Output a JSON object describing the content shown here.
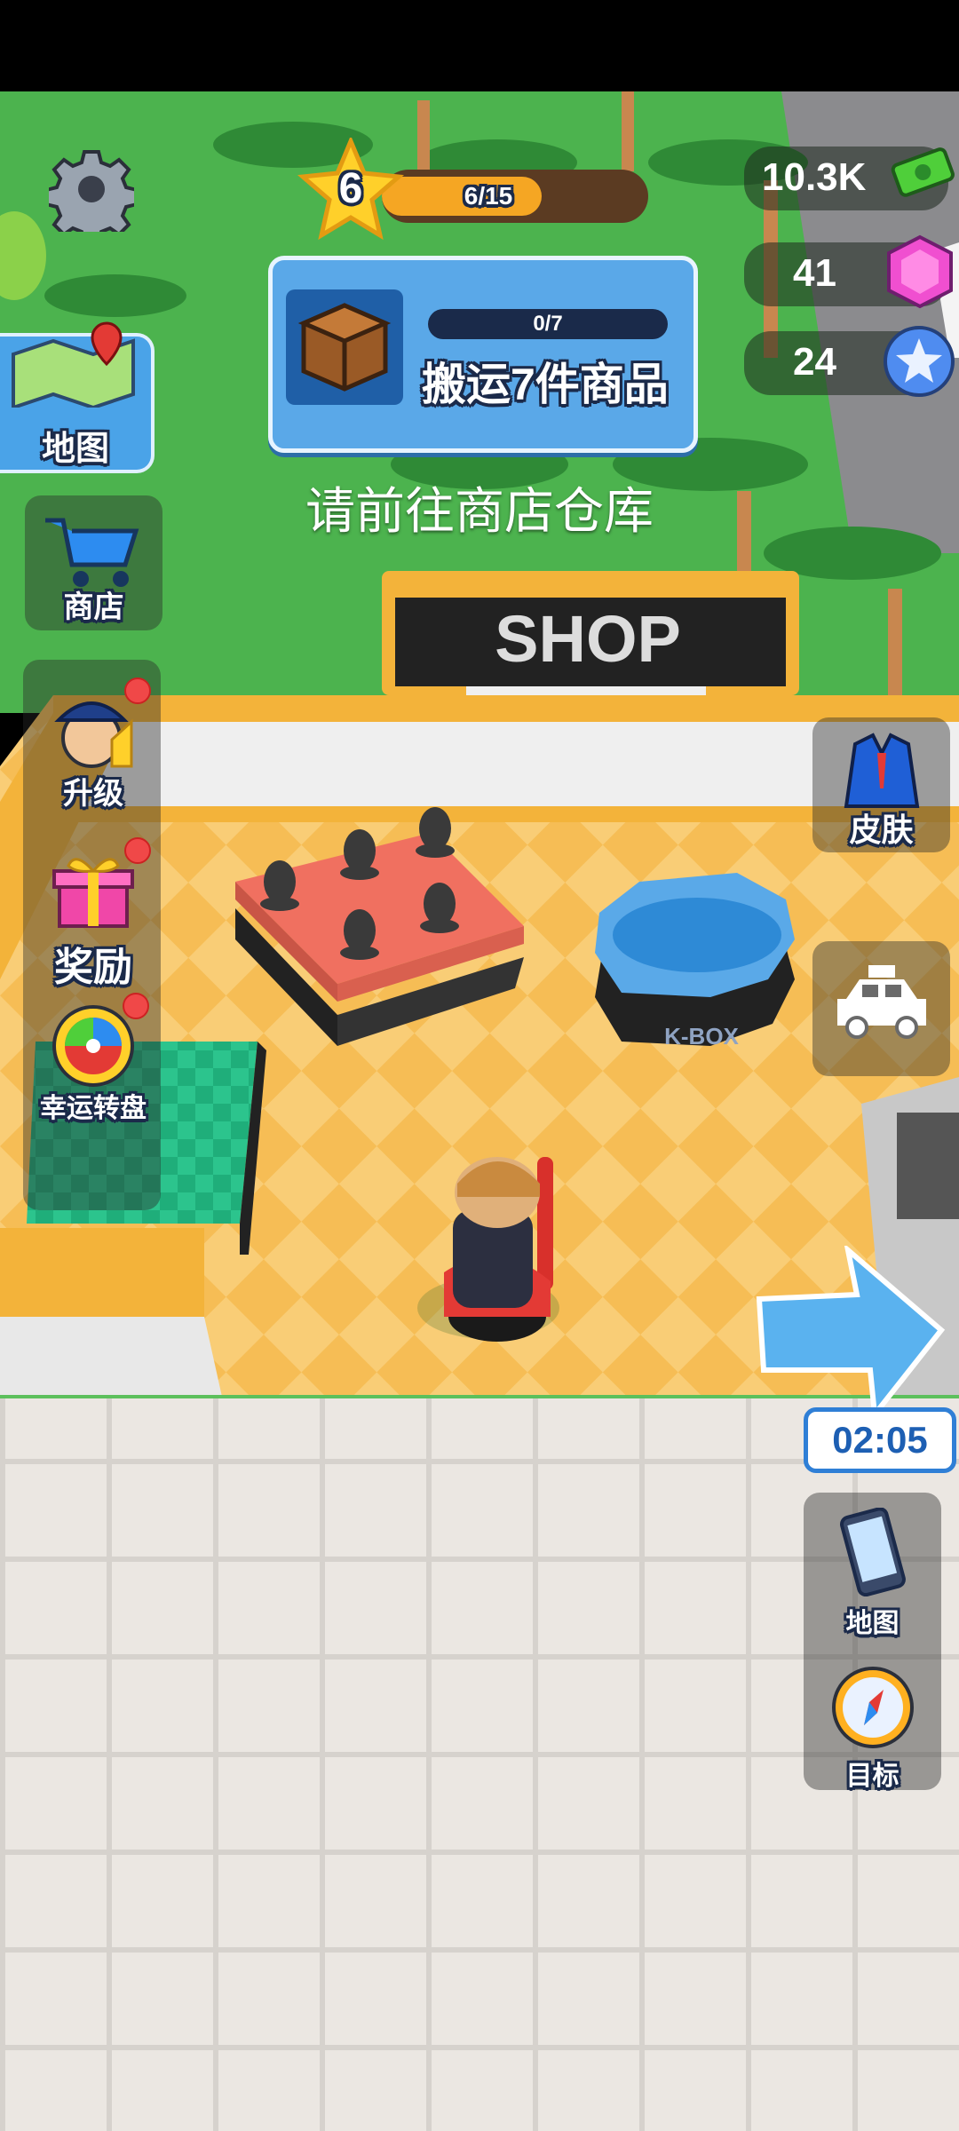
{
  "hud": {
    "level": "6",
    "xp_text": "6/15",
    "xp_progress": 0.4
  },
  "resources": {
    "cash": "10.3K",
    "gems": "41",
    "stars": "24"
  },
  "quest": {
    "progress_text": "0/7",
    "title": "搬运7件商品",
    "progress": 0
  },
  "hint": "请前往商店仓库",
  "left_menu": {
    "map": "地图",
    "shop": "商店",
    "upgrade": "升级",
    "reward": "奖励",
    "lucky_wheel": "幸运转盘"
  },
  "right_menu": {
    "skin": "皮肤",
    "timer": "02:05",
    "phone_map": "地图",
    "target": "目标"
  },
  "scene": {
    "shop_sign": "SHOP",
    "kbox_label": "K-BOX"
  },
  "colors": {
    "grass": "#46b04a",
    "floor_orange": "#f7b950",
    "quest_blue": "#5aa8e8",
    "xp_orange": "#f5a623",
    "arrow_blue": "#5ab2ef"
  }
}
